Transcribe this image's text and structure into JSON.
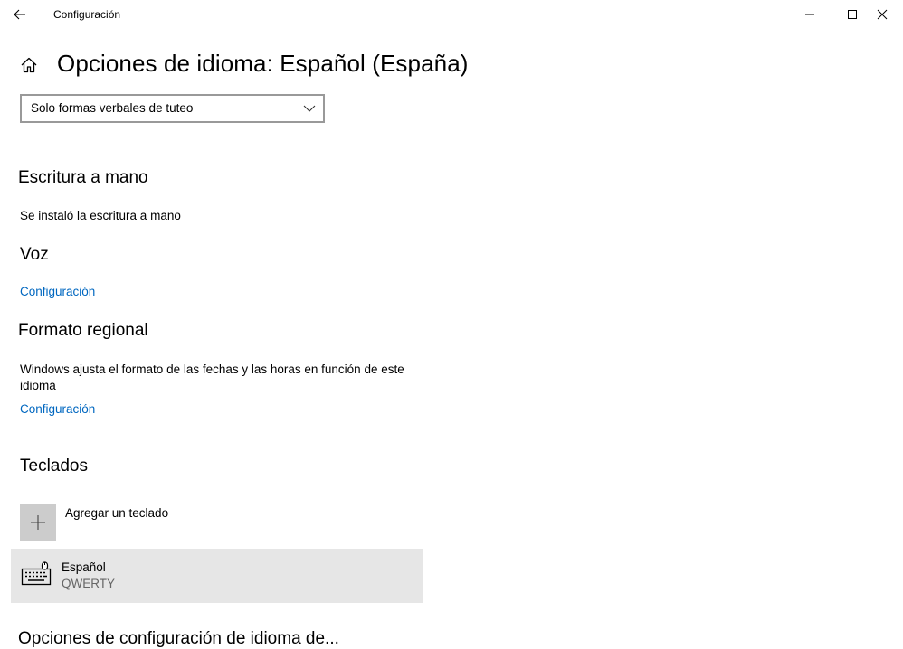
{
  "window": {
    "title": "Configuración"
  },
  "header": {
    "title": "Opciones de idioma: Español (España)"
  },
  "verb_forms_dropdown": {
    "selected": "Solo formas verbales de tuteo"
  },
  "handwriting": {
    "heading": "Escritura a mano",
    "status": "Se instaló la escritura a mano"
  },
  "speech": {
    "heading": "Voz",
    "link": "Configuración"
  },
  "regional_format": {
    "heading": "Formato regional",
    "description": "Windows ajusta el formato de las fechas y las horas en función de este idioma",
    "link": "Configuración"
  },
  "keyboards": {
    "heading": "Teclados",
    "add_label": "Agregar un teclado",
    "items": [
      {
        "name": "Español",
        "layout": "QWERTY"
      }
    ]
  },
  "next_section": {
    "heading": "Opciones de configuración de idioma de..."
  }
}
